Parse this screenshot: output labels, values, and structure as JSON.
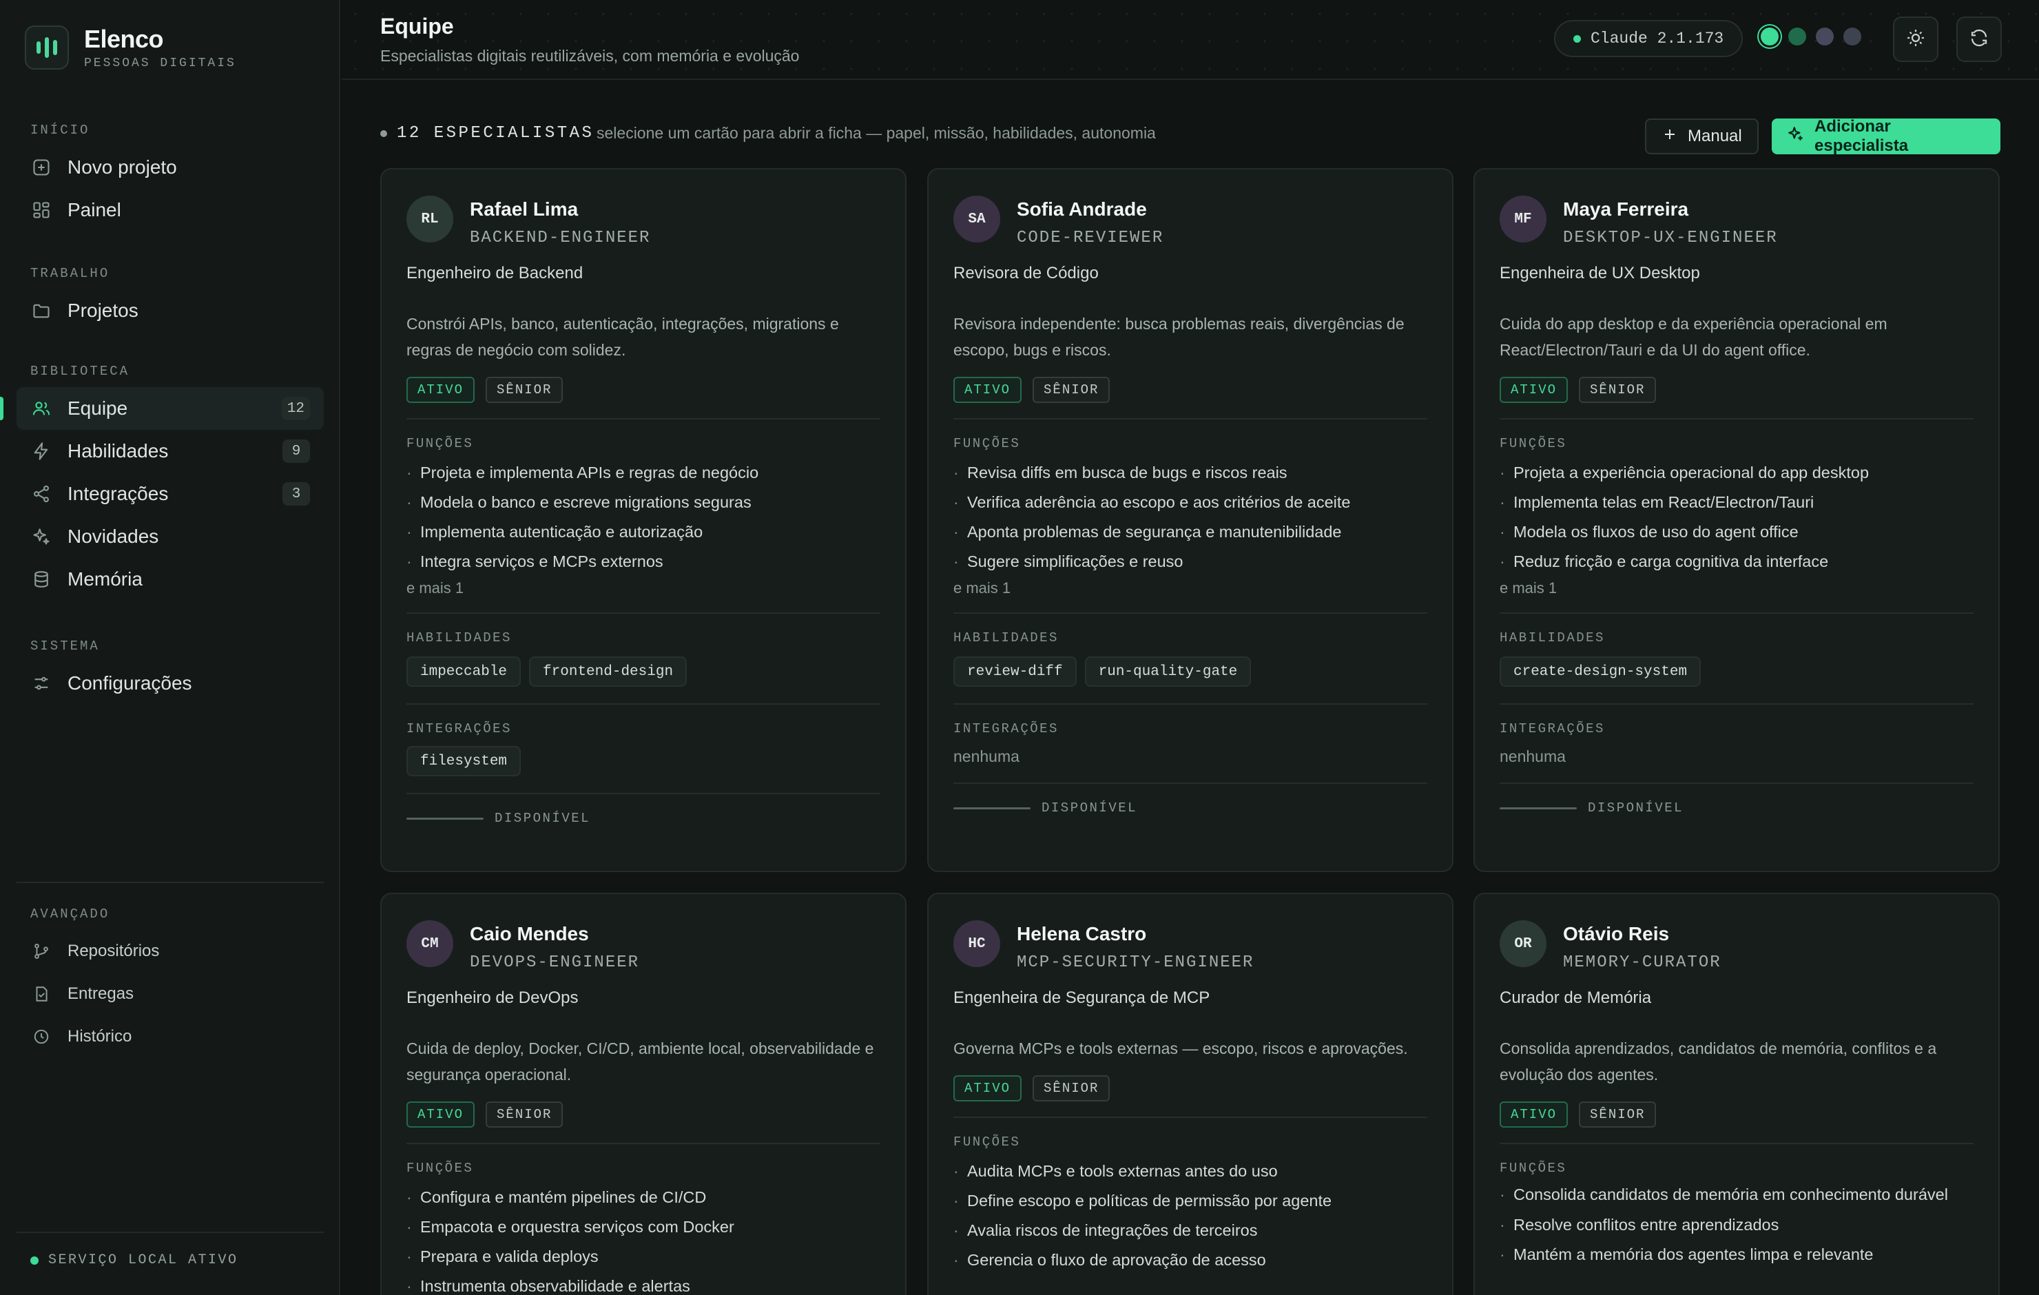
{
  "brand": {
    "name": "Elenco",
    "subtitle": "PESSOAS DIGITAIS"
  },
  "sidebar": {
    "sections": [
      {
        "label": "INÍCIO",
        "items": [
          {
            "label": "Novo projeto",
            "icon": "plus-square-icon"
          },
          {
            "label": "Painel",
            "icon": "dashboard-icon"
          }
        ]
      },
      {
        "label": "TRABALHO",
        "items": [
          {
            "label": "Projetos",
            "icon": "folder-icon"
          }
        ]
      },
      {
        "label": "BIBLIOTECA",
        "items": [
          {
            "label": "Equipe",
            "icon": "users-icon",
            "count": "12",
            "active": true
          },
          {
            "label": "Habilidades",
            "icon": "bolt-icon",
            "count": "9"
          },
          {
            "label": "Integrações",
            "icon": "share-icon",
            "count": "3"
          },
          {
            "label": "Novidades",
            "icon": "sparkle-icon"
          },
          {
            "label": "Memória",
            "icon": "database-icon"
          }
        ]
      },
      {
        "label": "SISTEMA",
        "items": [
          {
            "label": "Configurações",
            "icon": "sliders-icon"
          }
        ]
      }
    ],
    "advanced": {
      "label": "AVANÇADO",
      "items": [
        {
          "label": "Repositórios",
          "icon": "git-branch-icon"
        },
        {
          "label": "Entregas",
          "icon": "file-check-icon"
        },
        {
          "label": "Histórico",
          "icon": "clock-icon"
        }
      ]
    },
    "status": "SERVIÇO LOCAL ATIVO"
  },
  "header": {
    "title": "Equipe",
    "subtitle": "Especialistas digitais reutilizáveis, com memória e evolução",
    "version": "Claude 2.1.173",
    "theme_colors": [
      "#3ddc97",
      "#1f6b4c",
      "#464a5c",
      "#3e4350"
    ]
  },
  "toolbar": {
    "count": "12 ESPECIALISTAS",
    "hint": "selecione um cartão para abrir a ficha — papel, missão, habilidades, autonomia",
    "manual_label": "Manual",
    "add_label": "Adicionar especialista"
  },
  "labels": {
    "funcoes": "FUNÇÕES",
    "habilidades": "HABILIDADES",
    "integracoes": "INTEGRAÇÕES",
    "none": "nenhuma",
    "available": "DISPONÍVEL"
  },
  "cards": [
    {
      "initials": "RL",
      "avatar_color": "#2b3a34",
      "name": "Rafael Lima",
      "slug": "BACKEND-ENGINEER",
      "role": "Engenheiro de Backend",
      "desc": "Constrói APIs, banco, autenticação, integrações, migrations e regras de negócio com solidez.",
      "badges": [
        "ATIVO",
        "SÊNIOR"
      ],
      "functions": [
        "Projeta e implementa APIs e regras de negócio",
        "Modela o banco e escreve migrations seguras",
        "Implementa autenticação e autorização",
        "Integra serviços e MCPs externos"
      ],
      "more": "e mais 1",
      "skills": [
        "impeccable",
        "frontend-design"
      ],
      "integrations": [
        "filesystem"
      ],
      "status": "DISPONÍVEL"
    },
    {
      "initials": "SA",
      "avatar_color": "#3b3145",
      "name": "Sofia Andrade",
      "slug": "CODE-REVIEWER",
      "role": "Revisora de Código",
      "desc": "Revisora independente: busca problemas reais, divergências de escopo, bugs e riscos.",
      "badges": [
        "ATIVO",
        "SÊNIOR"
      ],
      "functions": [
        "Revisa diffs em busca de bugs e riscos reais",
        "Verifica aderência ao escopo e aos critérios de aceite",
        "Aponta problemas de segurança e manutenibilidade",
        "Sugere simplificações e reuso"
      ],
      "more": "e mais 1",
      "skills": [
        "review-diff",
        "run-quality-gate"
      ],
      "integrations": [],
      "status": "DISPONÍVEL"
    },
    {
      "initials": "MF",
      "avatar_color": "#3b3145",
      "name": "Maya Ferreira",
      "slug": "DESKTOP-UX-ENGINEER",
      "role": "Engenheira de UX Desktop",
      "desc": "Cuida do app desktop e da experiência operacional em React/Electron/Tauri e da UI do agent office.",
      "badges": [
        "ATIVO",
        "SÊNIOR"
      ],
      "functions": [
        "Projeta a experiência operacional do app desktop",
        "Implementa telas em React/Electron/Tauri",
        "Modela os fluxos de uso do agent office",
        "Reduz fricção e carga cognitiva da interface"
      ],
      "more": "e mais 1",
      "skills": [
        "create-design-system"
      ],
      "integrations": [],
      "status": "DISPONÍVEL"
    },
    {
      "initials": "CM",
      "avatar_color": "#3b3145",
      "name": "Caio Mendes",
      "slug": "DEVOPS-ENGINEER",
      "role": "Engenheiro de DevOps",
      "desc": "Cuida de deploy, Docker, CI/CD, ambiente local, observabilidade e segurança operacional.",
      "badges": [
        "ATIVO",
        "SÊNIOR"
      ],
      "functions": [
        "Configura e mantém pipelines de CI/CD",
        "Empacota e orquestra serviços com Docker",
        "Prepara e valida deploys",
        "Instrumenta observabilidade e alertas"
      ]
    },
    {
      "initials": "HC",
      "avatar_color": "#3b3145",
      "name": "Helena Castro",
      "slug": "MCP-SECURITY-ENGINEER",
      "role": "Engenheira de Segurança de MCP",
      "desc": "Governa MCPs e tools externas — escopo, riscos e aprovações.",
      "badges": [
        "ATIVO",
        "SÊNIOR"
      ],
      "functions": [
        "Audita MCPs e tools externas antes do uso",
        "Define escopo e políticas de permissão por agente",
        "Avalia riscos de integrações de terceiros",
        "Gerencia o fluxo de aprovação de acesso"
      ]
    },
    {
      "initials": "OR",
      "avatar_color": "#2b3a34",
      "name": "Otávio Reis",
      "slug": "MEMORY-CURATOR",
      "role": "Curador de Memória",
      "desc": "Consolida aprendizados, candidatos de memória, conflitos e a evolução dos agentes.",
      "badges": [
        "ATIVO",
        "SÊNIOR"
      ],
      "functions": [
        "Consolida candidatos de memória em conhecimento durável",
        "Resolve conflitos entre aprendizados",
        "Mantém a memória dos agentes limpa e relevante"
      ]
    }
  ]
}
